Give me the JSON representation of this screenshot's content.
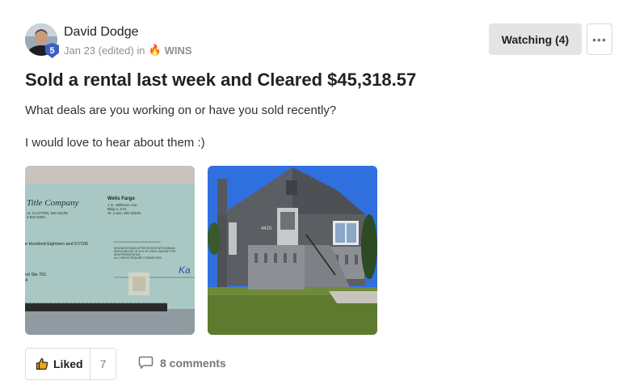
{
  "author": {
    "name": "David Dodge",
    "level_badge": "5",
    "date": "Jan 23 (edited) in",
    "group": "WINS"
  },
  "actions": {
    "watching_label": "Watching (4)",
    "more_label": "•••"
  },
  "post": {
    "title": "Sold a rental last week and Cleared $45,318.57",
    "paragraphs": [
      "What deals are you working on or have you sold recently?",
      "I would love to hear about them :)"
    ]
  },
  "check": {
    "company": "Title Company",
    "company_addr1": "AL CLAYTON, MO 63105",
    "company_addr2": "3 832-0303",
    "bank_name": "Wells Fargo",
    "bank_addr1": "1 N. Jefferson Ave",
    "bank_addr2": "Bldg 3, 3 FL",
    "bank_addr3": "St. Louis, MO 63103",
    "amount_words": "e Hundred Eighteen and 57/100",
    "stars": "*************************************",
    "notice1": "NON-NEGOTIABLE AFTER 90 DAYS WITH ANNUAL",
    "notice2": "SERVICING FEE OF 10% OF CHECK AMOUNT FOR",
    "notice3": "NON-PRESENTATION",
    "notice4": "ALL CHECKS REQUIRE 2 SIGNATURES",
    "payee_addr": "vd Ste 701",
    "payee_zip": "4",
    "signature": "Ka"
  },
  "house": {
    "address_plate": "4420"
  },
  "footer": {
    "liked_label": "Liked",
    "liked_count": "7",
    "comments_label": "8 comments"
  },
  "colors": {
    "badge": "#3c5fc4",
    "watch_bg": "#e4e4e4",
    "check_bg": "#a9c8c4",
    "sky": "#2f6fde",
    "house": "#5b5e63"
  }
}
